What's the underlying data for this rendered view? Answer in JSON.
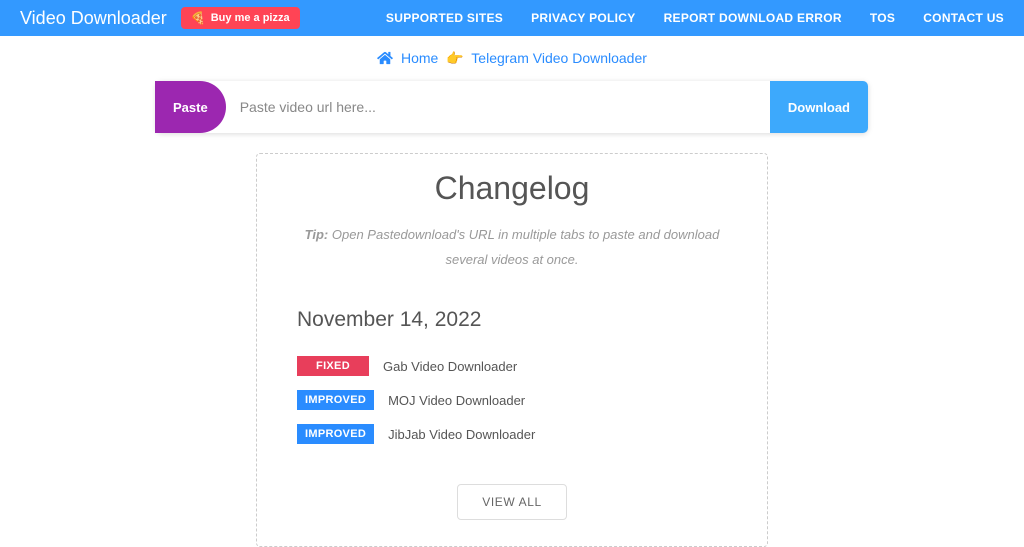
{
  "header": {
    "logo": "Video Downloader",
    "donate_label": "Buy me a pizza",
    "nav": [
      "SUPPORTED SITES",
      "PRIVACY POLICY",
      "REPORT DOWNLOAD ERROR",
      "TOS",
      "CONTACT US"
    ]
  },
  "breadcrumb": {
    "home": "Home",
    "current": "Telegram Video Downloader"
  },
  "input": {
    "paste_label": "Paste",
    "placeholder": "Paste video url here...",
    "download_label": "Download"
  },
  "changelog": {
    "title": "Changelog",
    "tip_label": "Tip:",
    "tip_text": "Open Pastedownload's URL in multiple tabs to paste and download several videos at once.",
    "date": "November 14, 2022",
    "items": [
      {
        "badge": "FIXED",
        "type": "fixed",
        "text": "Gab Video Downloader"
      },
      {
        "badge": "IMPROVED",
        "type": "improved",
        "text": "MOJ Video Downloader"
      },
      {
        "badge": "IMPROVED",
        "type": "improved",
        "text": "JibJab Video Downloader"
      }
    ],
    "view_all": "VIEW ALL"
  }
}
